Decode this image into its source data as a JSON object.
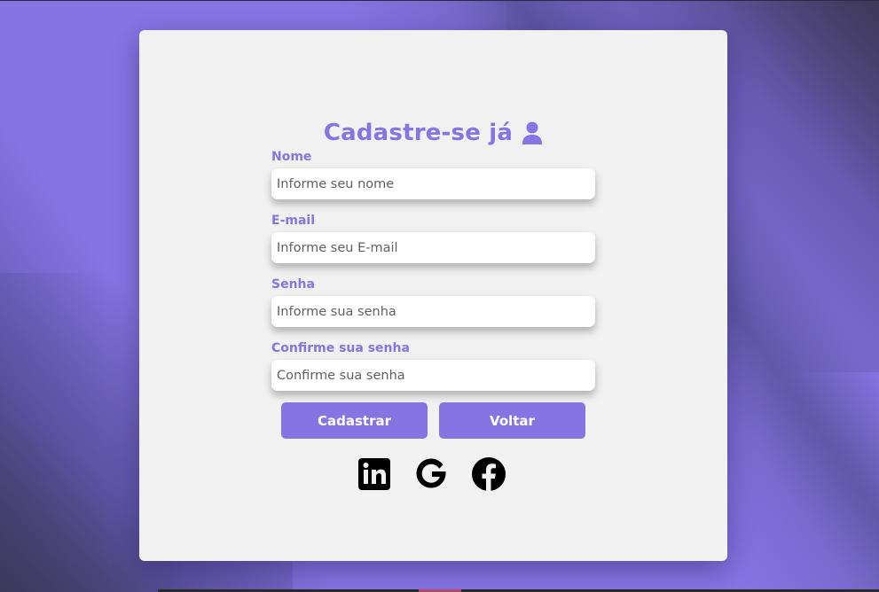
{
  "form": {
    "title": "Cadastre-se já",
    "title_icon": "user-icon",
    "fields": [
      {
        "label": "Nome",
        "placeholder": "Informe seu nome",
        "value": ""
      },
      {
        "label": "E-mail",
        "placeholder": "Informe seu E-mail",
        "value": ""
      },
      {
        "label": "Senha",
        "placeholder": "Informe sua senha",
        "value": ""
      },
      {
        "label": "Confirme sua senha",
        "placeholder": "Confirme sua senha",
        "value": ""
      }
    ],
    "submit_label": "Cadastrar",
    "back_label": "Voltar"
  },
  "social": {
    "icons": [
      "linkedin-icon",
      "google-icon",
      "facebook-icon"
    ]
  },
  "colors": {
    "accent": "#8674e2",
    "card_background": "#f1f1f1",
    "social_icon": "#000000"
  }
}
